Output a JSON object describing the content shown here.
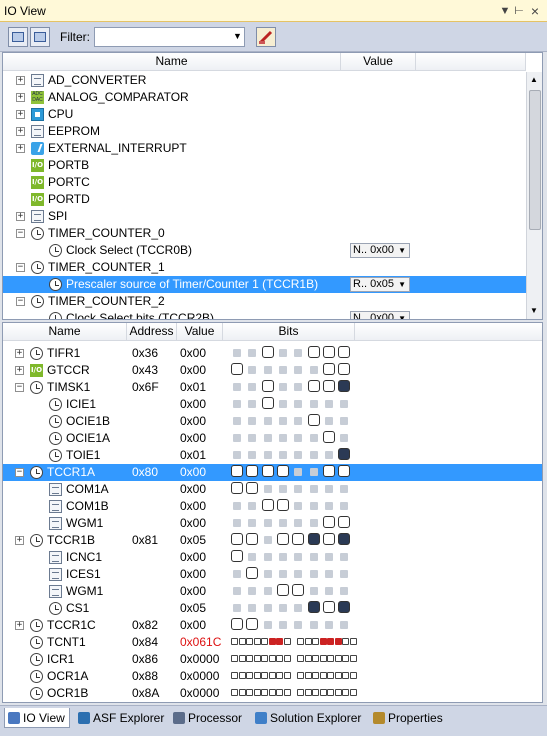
{
  "window": {
    "title": "IO View",
    "dropdown_glyph": "▼",
    "pin_glyph": "🖈",
    "close_glyph": "×"
  },
  "toolbar": {
    "filter_label": "Filter:",
    "filter_value": ""
  },
  "tree": {
    "headers": {
      "name": "Name",
      "value": "Value"
    },
    "rows": [
      {
        "label": "AD_CONVERTER",
        "icon": "document-icon",
        "expander": "+"
      },
      {
        "label": "ANALOG_COMPARATOR",
        "icon": "adc-dac-icon",
        "expander": "+"
      },
      {
        "label": "CPU",
        "icon": "cpu-icon",
        "expander": "+"
      },
      {
        "label": "EEPROM",
        "icon": "document-icon",
        "expander": "+"
      },
      {
        "label": "EXTERNAL_INTERRUPT",
        "icon": "interrupt-icon",
        "expander": "+"
      },
      {
        "label": "PORTB",
        "icon": "io-icon",
        "expander": ""
      },
      {
        "label": "PORTC",
        "icon": "io-icon",
        "expander": ""
      },
      {
        "label": "PORTD",
        "icon": "io-icon",
        "expander": ""
      },
      {
        "label": "SPI",
        "icon": "document-icon",
        "expander": "+"
      },
      {
        "label": "TIMER_COUNTER_0",
        "icon": "clock-icon",
        "expander": "−"
      },
      {
        "label": "Clock Select (TCCR0B)",
        "icon": "clock-icon",
        "expander": "",
        "value": "N.. 0x00"
      },
      {
        "label": "TIMER_COUNTER_1",
        "icon": "clock-icon",
        "expander": "−"
      },
      {
        "label": "Prescaler source of Timer/Counter 1 (TCCR1B)",
        "icon": "clock-icon",
        "expander": "",
        "value": "R.. 0x05",
        "selected": true
      },
      {
        "label": "TIMER_COUNTER_2",
        "icon": "clock-icon",
        "expander": "−"
      },
      {
        "label": "Clock Select bits (TCCR2B)",
        "icon": "clock-icon",
        "expander": "",
        "value": "N.. 0x00"
      }
    ]
  },
  "registers": {
    "headers": {
      "name": "Name",
      "address": "Address",
      "value": "Value",
      "bits": "Bits"
    },
    "rows": [
      {
        "name": "TIFR1",
        "icon": "clock-icon",
        "expander": "+",
        "address": "0x36",
        "value": "0x00",
        "bits": "..0..000"
      },
      {
        "name": "GTCCR",
        "icon": "io-icon",
        "expander": "+",
        "address": "0x43",
        "value": "0x00",
        "bits": "0.....00"
      },
      {
        "name": "TIMSK1",
        "icon": "clock-icon",
        "expander": "−",
        "address": "0x6F",
        "value": "0x01",
        "bits": "..0..001"
      },
      {
        "name": "ICIE1",
        "icon": "clock-icon",
        "child": true,
        "address": "",
        "value": "0x00",
        "bits": "..0....."
      },
      {
        "name": "OCIE1B",
        "icon": "clock-icon",
        "child": true,
        "address": "",
        "value": "0x00",
        "bits": ".....0.."
      },
      {
        "name": "OCIE1A",
        "icon": "clock-icon",
        "child": true,
        "address": "",
        "value": "0x00",
        "bits": "......0."
      },
      {
        "name": "TOIE1",
        "icon": "clock-icon",
        "child": true,
        "address": "",
        "value": "0x01",
        "bits": ".......1"
      },
      {
        "name": "TCCR1A",
        "icon": "clock-icon",
        "expander": "−",
        "address": "0x80",
        "value": "0x00",
        "bits": "0000..00",
        "selected": true
      },
      {
        "name": "COM1A",
        "icon": "document-icon",
        "child": true,
        "address": "",
        "value": "0x00",
        "bits": "00......"
      },
      {
        "name": "COM1B",
        "icon": "document-icon",
        "child": true,
        "address": "",
        "value": "0x00",
        "bits": "..00...."
      },
      {
        "name": "WGM1",
        "icon": "document-icon",
        "child": true,
        "address": "",
        "value": "0x00",
        "bits": "......00"
      },
      {
        "name": "TCCR1B",
        "icon": "clock-icon",
        "expander": "+",
        "address": "0x81",
        "value": "0x05",
        "bits": "00.00101"
      },
      {
        "name": "ICNC1",
        "icon": "document-icon",
        "child": true,
        "address": "",
        "value": "0x00",
        "bits": "0......."
      },
      {
        "name": "ICES1",
        "icon": "document-icon",
        "child": true,
        "address": "",
        "value": "0x00",
        "bits": ".0......"
      },
      {
        "name": "WGM1",
        "icon": "document-icon",
        "child": true,
        "address": "",
        "value": "0x00",
        "bits": "...00..."
      },
      {
        "name": "CS1",
        "icon": "clock-icon",
        "child": true,
        "address": "",
        "value": "0x05",
        "bits": ".....101"
      },
      {
        "name": "TCCR1C",
        "icon": "clock-icon",
        "expander": "+",
        "address": "0x82",
        "value": "0x00",
        "bits": "00......"
      },
      {
        "name": "TCNT1",
        "icon": "clock-icon",
        "address": "0x84",
        "value": "0x061C",
        "value_red": true,
        "small_bits": "0000011000011100"
      },
      {
        "name": "ICR1",
        "icon": "clock-icon",
        "address": "0x86",
        "value": "0x0000",
        "small_bits": "0000000000000000"
      },
      {
        "name": "OCR1A",
        "icon": "clock-icon",
        "address": "0x88",
        "value": "0x0000",
        "small_bits": "0000000000000000"
      },
      {
        "name": "OCR1B",
        "icon": "clock-icon",
        "address": "0x8A",
        "value": "0x0000",
        "small_bits": "0000000000000000"
      }
    ]
  },
  "tabs": [
    {
      "label": "IO View",
      "active": true,
      "icon": "io-view-icon"
    },
    {
      "label": "ASF Explorer",
      "icon": "asf-icon"
    },
    {
      "label": "Processor",
      "icon": "processor-icon"
    },
    {
      "label": "Solution Explorer",
      "icon": "solution-explorer-icon"
    },
    {
      "label": "Properties",
      "icon": "properties-icon"
    }
  ]
}
